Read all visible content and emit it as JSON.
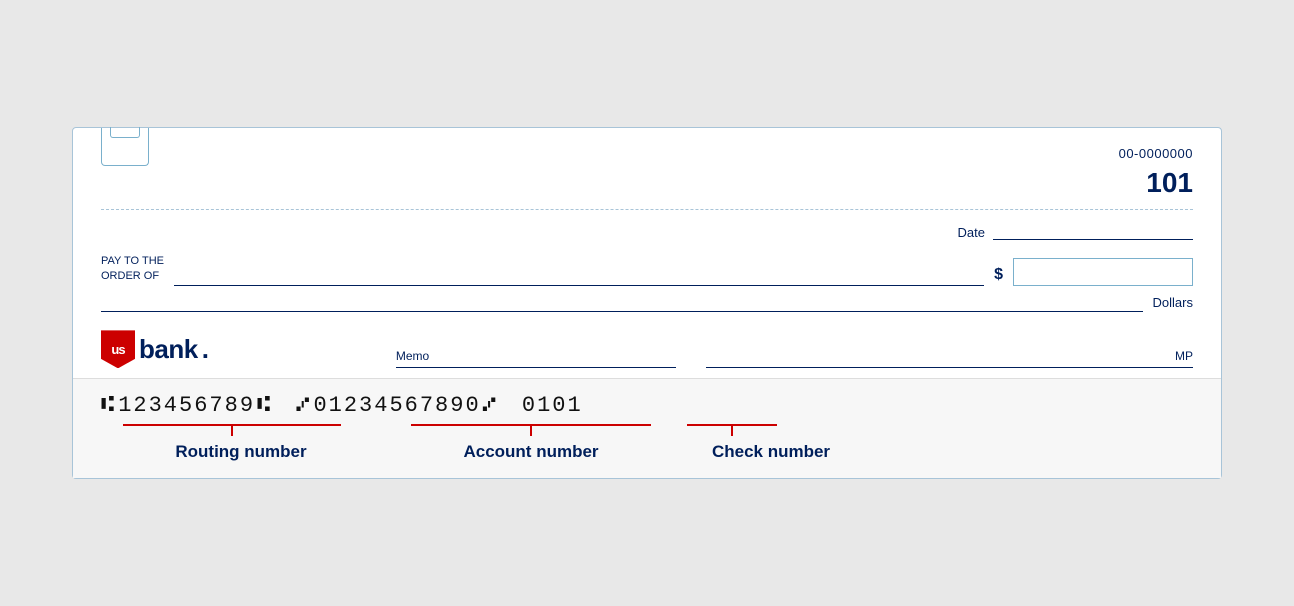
{
  "check": {
    "routing_fraction": "00-0000000",
    "check_number_top": "101",
    "date_label": "Date",
    "pay_label_line1": "PAY TO THE",
    "pay_label_line2": "ORDER OF",
    "dollar_sign": "$",
    "dollars_label": "Dollars",
    "memo_label": "Memo",
    "mp_label": "MP",
    "micr": {
      "routing_open": "⑆",
      "routing_number": "123456789",
      "routing_close": "⑆",
      "account_open": "⑇",
      "account_number": "01234567890",
      "account_close": "⑇",
      "check_number": "0101"
    },
    "labels": {
      "routing": "Routing number",
      "account": "Account number",
      "check": "Check number"
    }
  }
}
